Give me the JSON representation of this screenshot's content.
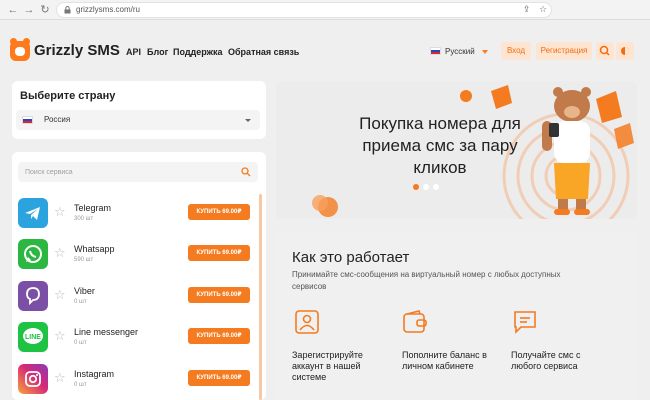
{
  "browser": {
    "url": "grizzlysms.com/ru"
  },
  "header": {
    "brand": "Grizzly SMS",
    "nav": [
      "API",
      "Блог",
      "Поддержка",
      "Обратная связь"
    ],
    "language": "Русский",
    "login_label": "Вход",
    "register_label": "Регистрация"
  },
  "country": {
    "title": "Выберите страну",
    "selected": "Россия"
  },
  "search": {
    "placeholder": "Поиск сервиса"
  },
  "services": [
    {
      "name": "Telegram",
      "count": "300 шт",
      "button": "КУПИТЬ 69.00₽",
      "color": "#2aa3de"
    },
    {
      "name": "Whatsapp",
      "count": "590 шт",
      "button": "КУПИТЬ 69.00₽",
      "color": "#2bb741"
    },
    {
      "name": "Viber",
      "count": "0 шт",
      "button": "КУПИТЬ 69.00₽",
      "color": "#7b4fa6"
    },
    {
      "name": "Line messenger",
      "count": "0 шт",
      "button": "КУПИТЬ 69.00₽",
      "color": "#1ec344"
    },
    {
      "name": "Instagram",
      "count": "0 шт",
      "button": "КУПИТЬ 69.00₽",
      "color": "#d62976"
    }
  ],
  "hero": {
    "title": "Покупка номера для приема смс за пару кликов",
    "slides": 3,
    "active_slide": 1
  },
  "how": {
    "title": "Как это работает",
    "subtitle": "Принимайте смс-сообщения на виртуальный номер с любых доступных сервисов",
    "steps": [
      {
        "text": "Зарегистрируйте аккаунт в нашей системе",
        "icon": "user-card-icon"
      },
      {
        "text": "Пополните баланс в личном кабинете",
        "icon": "wallet-icon"
      },
      {
        "text": "Получайте смс с любого сервиса",
        "icon": "message-icon"
      }
    ]
  },
  "colors": {
    "accent": "#f47b20",
    "accent_light": "#fde5d2"
  }
}
